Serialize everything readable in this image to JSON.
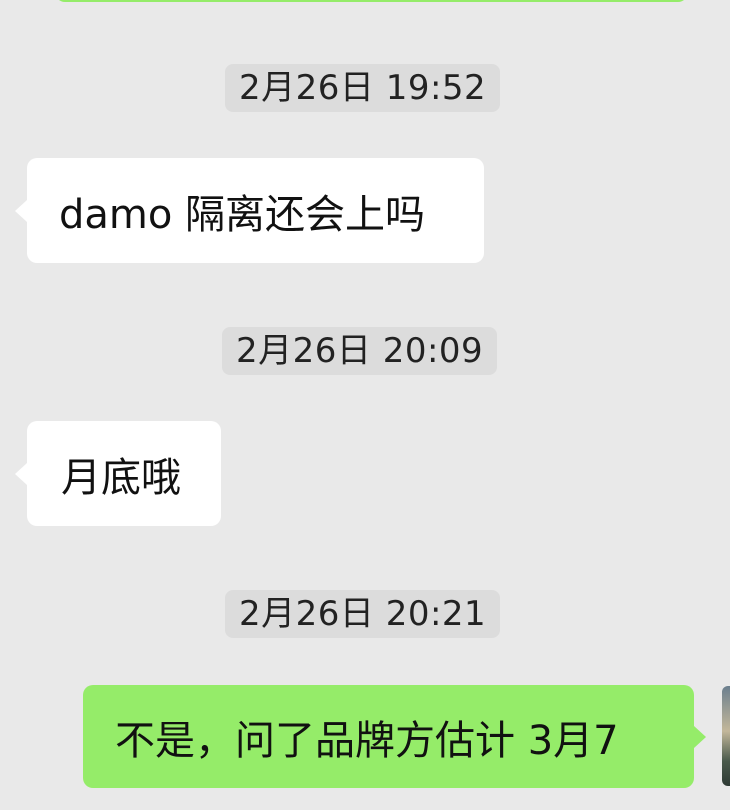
{
  "messages": [
    {
      "kind": "timestamp",
      "text": "2月26日 19:52"
    },
    {
      "kind": "incoming",
      "text": "damo 隔离还会上吗"
    },
    {
      "kind": "timestamp",
      "text": "2月26日 20:09"
    },
    {
      "kind": "incoming",
      "text": "月底哦"
    },
    {
      "kind": "timestamp",
      "text": "2月26日 20:21"
    },
    {
      "kind": "outgoing",
      "text": "不是，问了品牌方估计 3月7"
    }
  ],
  "colors": {
    "background": "#e9e9e9",
    "incoming_bubble": "#ffffff",
    "outgoing_bubble": "#95ec69",
    "timestamp_pill": "#dcdcdc"
  }
}
